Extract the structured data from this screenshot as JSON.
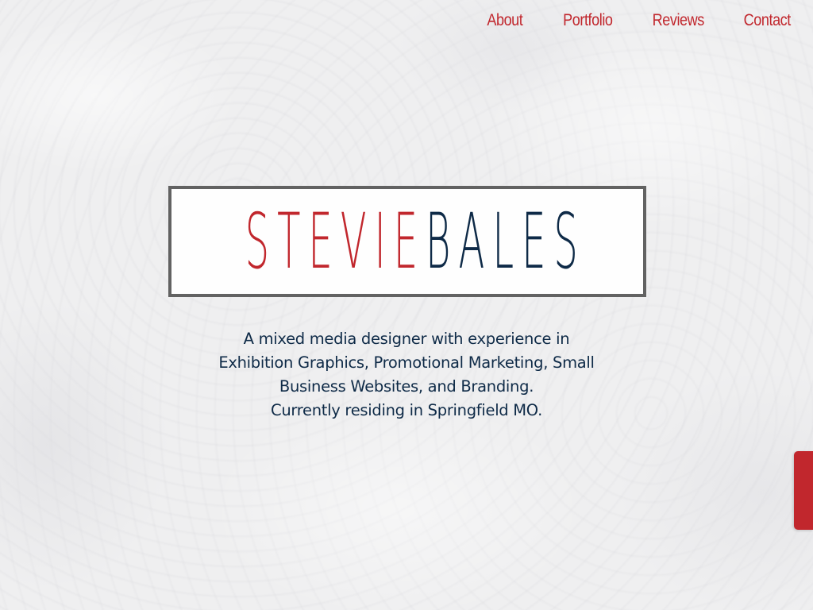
{
  "colors": {
    "accent_red": "#c1272d",
    "navy": "#0e2a47",
    "logo_border": "#626262"
  },
  "nav": {
    "items": [
      {
        "label": "About"
      },
      {
        "label": "Portfolio"
      },
      {
        "label": "Reviews"
      },
      {
        "label": "Contact"
      }
    ]
  },
  "logo": {
    "first": "STEVIE",
    "last": "BALES"
  },
  "tagline": {
    "lines": [
      "A mixed media designer with experience in",
      "Exhibition Graphics, Promotional Marketing, Small",
      "Business Websites, and Branding.",
      "Currently residing in Springfield MO."
    ]
  }
}
